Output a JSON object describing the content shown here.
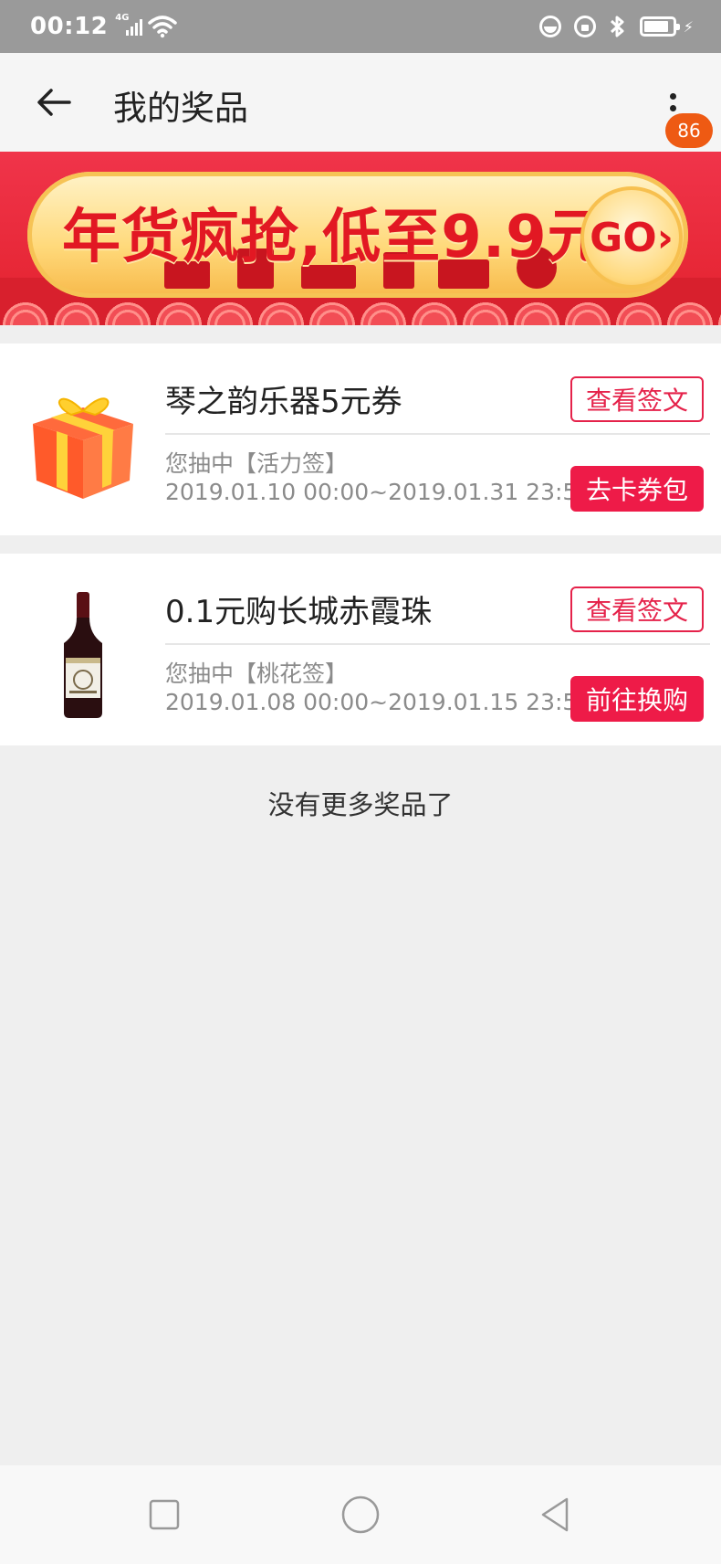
{
  "status_bar": {
    "time": "00:12",
    "network": "4G"
  },
  "header": {
    "title": "我的奖品",
    "badge_count": "86",
    "back_icon": "arrow-left-icon",
    "more_icon": "more-vertical-icon"
  },
  "banner": {
    "headline": "年货疯抢,低至9.9元",
    "go_label": "GO›"
  },
  "prizes": [
    {
      "title": "琴之韵乐器5元券",
      "from": "您抽中【活力签】",
      "date": "2019.01.10 00:00~2019.01.31 23:59",
      "view_label": "查看签文",
      "action_label": "去卡券包",
      "thumb": "gift-box-icon"
    },
    {
      "title": "0.1元购长城赤霞珠",
      "from": "您抽中【桃花签】",
      "date": "2019.01.08 00:00~2019.01.15 23:59",
      "view_label": "查看签文",
      "action_label": "前往换购",
      "thumb": "wine-bottle-icon"
    }
  ],
  "footer_text": "没有更多奖品了",
  "colors": {
    "accent": "#ee1b48",
    "badge": "#ee5a13",
    "background": "#efefef"
  }
}
